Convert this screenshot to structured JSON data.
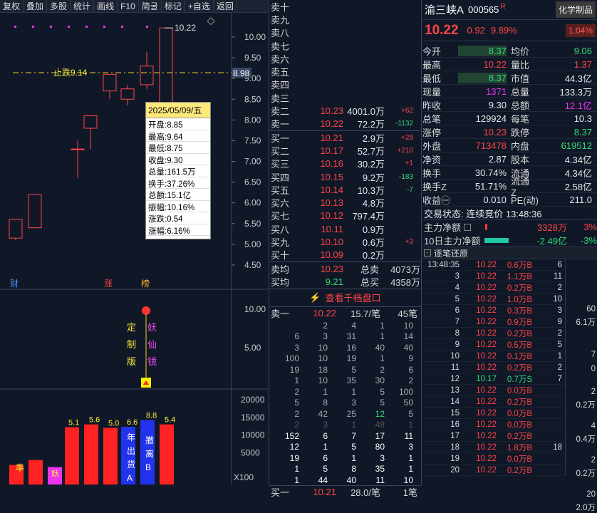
{
  "toolbar": [
    "复权",
    "叠加",
    "多股",
    "统计",
    "画线",
    "F10",
    "简굴",
    "标记",
    "+自选",
    "返回"
  ],
  "chart": {
    "price_axis": [
      "10.00",
      "9.50",
      "9.00",
      "8.50",
      "8.00",
      "7.50",
      "7.00",
      "6.50",
      "6.00",
      "5.50",
      "5.00",
      "4.50"
    ],
    "high_label": "10.22",
    "stop_label": "止跌9.14",
    "cross_price": "8.98",
    "markers": [
      "财",
      "涨",
      "榜"
    ],
    "ind_axis": [
      "10.00",
      "5.00"
    ],
    "ind_texts": [
      "定制版",
      "妖仙镜"
    ],
    "vol_axis": [
      "20000",
      "15000",
      "10000",
      "5000"
    ],
    "vol_unit": "X100",
    "vol_labels": [
      "5.1",
      "5.6",
      "5.0",
      "6.6",
      "8.8",
      "5.4"
    ],
    "bar_texts": [
      "年出货A",
      "撤离B"
    ],
    "small_marks": [
      "準",
      "妖"
    ],
    "tooltip": {
      "date": "2025/05/09/五",
      "rows": [
        "开盘:8.85",
        "最高:9.64",
        "最低:8.75",
        "收盘:9.30",
        "总量:161.5万",
        "换手:37.26%",
        "总额:15.1亿",
        "振幅:10.16%",
        "涨跌:0.54",
        "涨幅:6.16%"
      ]
    }
  },
  "book": {
    "sell_empty": [
      "卖十",
      "卖九",
      "卖八",
      "卖七",
      "卖六",
      "卖五",
      "卖四",
      "卖三"
    ],
    "sells": [
      {
        "l": "卖二",
        "p": "10.23",
        "v": "4001.0万",
        "c": "+62"
      },
      {
        "l": "卖一",
        "p": "10.22",
        "v": "72.2万",
        "c": "-1132"
      }
    ],
    "buys": [
      {
        "l": "买一",
        "p": "10.21",
        "v": "2.9万",
        "c": "+28"
      },
      {
        "l": "买二",
        "p": "10.17",
        "v": "52.7万",
        "c": "+210"
      },
      {
        "l": "买三",
        "p": "10.16",
        "v": "30.2万",
        "c": "+1"
      },
      {
        "l": "买四",
        "p": "10.15",
        "v": "9.2万",
        "c": "-183"
      },
      {
        "l": "买五",
        "p": "10.14",
        "v": "10.3万",
        "c": "-7"
      },
      {
        "l": "买六",
        "p": "10.13",
        "v": "4.8万",
        "c": ""
      },
      {
        "l": "买七",
        "p": "10.12",
        "v": "797.4万",
        "c": ""
      },
      {
        "l": "买八",
        "p": "10.11",
        "v": "0.9万",
        "c": ""
      },
      {
        "l": "买九",
        "p": "10.10",
        "v": "0.6万",
        "c": "+3"
      },
      {
        "l": "买十",
        "p": "10.09",
        "v": "0.2万",
        "c": ""
      }
    ],
    "avg_sell": {
      "l": "卖均",
      "p": "10.23",
      "t": "总卖",
      "v": "4073万"
    },
    "avg_buy": {
      "l": "买均",
      "p": "9.21",
      "t": "总买",
      "v": "4358万"
    },
    "qiandang": "查看千档盘口",
    "q_head": {
      "l": "卖一",
      "p": "10.22",
      "r": "15.7/笔",
      "n": "45笔"
    },
    "qrows": [
      [
        "2",
        "4",
        "1",
        "10"
      ],
      [
        "6",
        "3",
        "31",
        "1",
        "14"
      ],
      [
        "3",
        "10",
        "16",
        "40",
        "40"
      ],
      [
        "100",
        "10",
        "19",
        "1",
        "9"
      ],
      [
        "19",
        "18",
        "5",
        "2",
        "6"
      ],
      [
        "1",
        "10",
        "35",
        "30",
        "2"
      ],
      [
        "2",
        "1",
        "1",
        "5",
        "100"
      ],
      [
        "5",
        "8",
        "3",
        "5",
        "50"
      ],
      [
        "2",
        "42",
        "25",
        "12",
        "5"
      ],
      [
        "2",
        "3",
        "1",
        "48",
        "1"
      ],
      [
        "152",
        "6",
        "7",
        "17",
        "11"
      ],
      [
        "12",
        "1",
        "5",
        "80",
        "3"
      ],
      [
        "19",
        "6",
        "1",
        "3",
        "1"
      ],
      [
        "1",
        "5",
        "8",
        "35",
        "1"
      ],
      [
        "1",
        "44",
        "40",
        "11",
        "10"
      ]
    ],
    "bottom": {
      "l": "买一",
      "p": "10.21",
      "r": "28.0/笔",
      "n": "1笔"
    }
  },
  "quote": {
    "name": "渝三峡A",
    "code": "000565",
    "sector": "化学制品",
    "price": "10.22",
    "chg": "0.92",
    "pct": "9.89%",
    "sector_pct": "1.04%",
    "rows": [
      [
        "今开",
        "8.37",
        "均价",
        "9.06"
      ],
      [
        "最高",
        "10.22",
        "量比",
        "1.37"
      ],
      [
        "最低",
        "8.37",
        "市值",
        "44.3亿"
      ],
      [
        "现量",
        "1371",
        "总量",
        "133.3万"
      ],
      [
        "昨收",
        "9.30",
        "总额",
        "12.1亿"
      ],
      [
        "总笔",
        "129924",
        "每笔",
        "10.3"
      ],
      [
        "涨停",
        "10.23",
        "跌停",
        "8.37"
      ],
      [
        "外盘",
        "713478",
        "内盘",
        "619512"
      ],
      [
        "净资",
        "2.87",
        "股本",
        "4.34亿"
      ],
      [
        "换手",
        "30.74%",
        "流通",
        "4.34亿"
      ],
      [
        "换手Z",
        "51.71%",
        "流通Z",
        "2.58亿"
      ],
      [
        "收益㊀",
        "0.010",
        "PE(动)",
        "211.0"
      ]
    ],
    "trade_state": "交易状态: 连续竞价 13:48:36",
    "main_net": {
      "l": "主力净额",
      "v": "3328万",
      "p": "3%"
    },
    "ten_day": {
      "l": "10日主力净额",
      "v": "-2.49亿",
      "p": "-3%"
    },
    "tick_title": "逐笔还原",
    "ticks": [
      [
        "13:48:35",
        "10.22",
        "0.6万B",
        "6"
      ],
      [
        "3",
        "10.22",
        "1.1万B",
        "11"
      ],
      [
        "4",
        "10.22",
        "0.2万B",
        "2"
      ],
      [
        "5",
        "10.22",
        "1.0万B",
        "10"
      ],
      [
        "6",
        "10.22",
        "0.3万B",
        "3"
      ],
      [
        "7",
        "10.22",
        "0.9万B",
        "9"
      ],
      [
        "8",
        "10.22",
        "0.2万B",
        "2"
      ],
      [
        "9",
        "10.22",
        "0.5万B",
        "5"
      ],
      [
        "10",
        "10.22",
        "0.1万B",
        "1"
      ],
      [
        "11",
        "10.22",
        "0.2万B",
        "2"
      ],
      [
        "12",
        "10.17",
        "0.7万S",
        "7"
      ],
      [
        "13",
        "10.22",
        "0.0万B",
        ""
      ],
      [
        "14",
        "10.22",
        "0.2万B",
        ""
      ],
      [
        "15",
        "10.22",
        "0.0万B",
        ""
      ],
      [
        "16",
        "10.22",
        "0.0万B",
        ""
      ],
      [
        "17",
        "10.22",
        "0.2万B",
        ""
      ],
      [
        "18",
        "10.22",
        "1.8万B",
        "18"
      ],
      [
        "19",
        "10.22",
        "0.0万B",
        ""
      ],
      [
        "20",
        "10.22",
        "0.2万B",
        ""
      ]
    ],
    "side": [
      "60",
      "6.1万",
      "7",
      "0",
      "2",
      "0.2万",
      "4",
      "0.4万",
      "2",
      "0.2万",
      "20",
      "2.0万"
    ]
  }
}
